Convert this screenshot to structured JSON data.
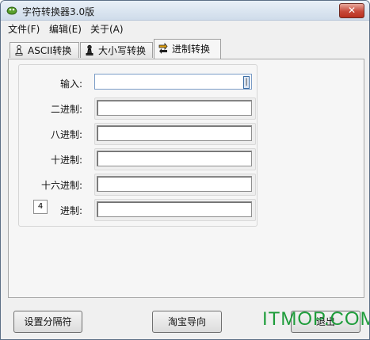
{
  "window": {
    "title": "字符转换器3.0版",
    "close_label": "✕"
  },
  "menu": [
    "文件(F)",
    "编辑(E)",
    "关于(A)"
  ],
  "tabs": [
    {
      "label": "ASCII转换",
      "icon": "pawn-white-icon",
      "active": false
    },
    {
      "label": "大小写转换",
      "icon": "pawn-black-icon",
      "active": false
    },
    {
      "label": "进制转换",
      "icon": "arrow-swap-icon",
      "active": true
    }
  ],
  "form": {
    "input_label": "输入:",
    "binary_label": "二进制:",
    "octal_label": "八进制:",
    "decimal_label": "十进制:",
    "hex_label": "十六进制:",
    "base_label": "进制:",
    "base_value": "4",
    "input_cursor": "|"
  },
  "buttons": {
    "separator": "设置分隔符",
    "taobao": "淘宝导向",
    "exit": "退出"
  },
  "watermark": "ITMOP.COM"
}
